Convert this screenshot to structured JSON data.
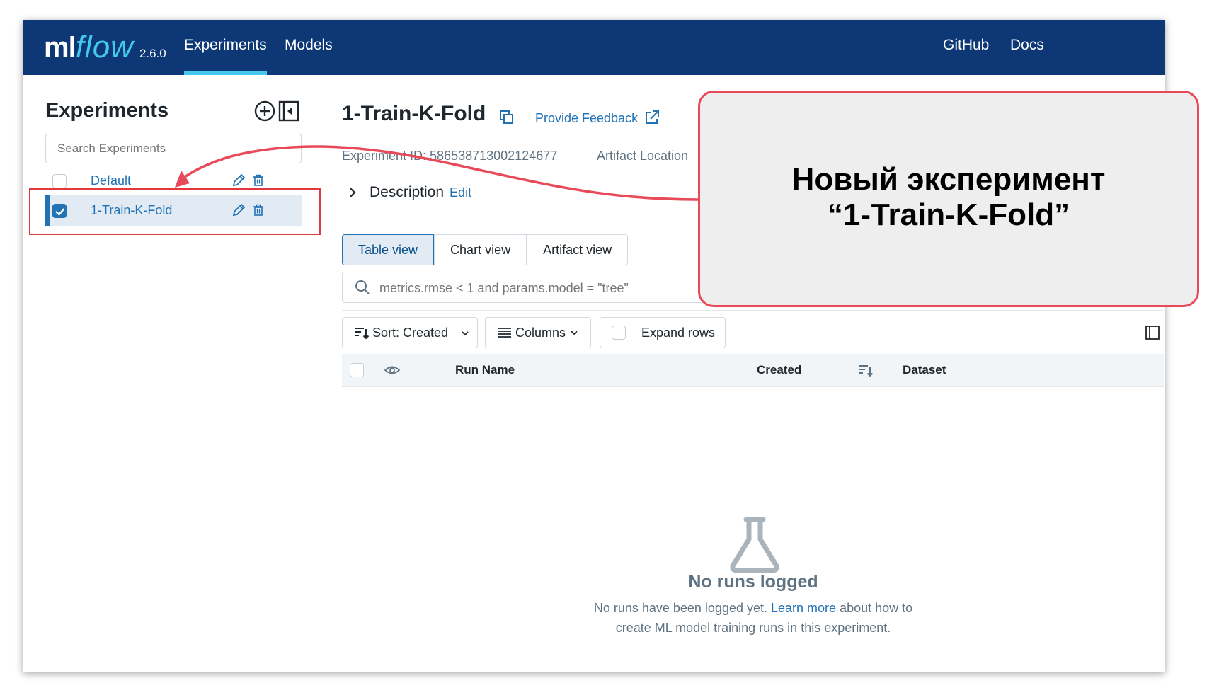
{
  "header": {
    "logo_ml": "ml",
    "logo_flow": "flow",
    "version": "2.6.0",
    "nav": [
      "Experiments",
      "Models"
    ],
    "right_nav": [
      "GitHub",
      "Docs"
    ]
  },
  "sidebar": {
    "title": "Experiments",
    "search_placeholder": "Search Experiments",
    "experiments": [
      {
        "name": "Default",
        "checked": false
      },
      {
        "name": "1-Train-K-Fold",
        "checked": true
      }
    ]
  },
  "main": {
    "title": "1-Train-K-Fold",
    "feedback_link": "Provide Feedback",
    "experiment_id_label": "Experiment ID: 586538713002124677",
    "artifact_label": "Artifact Location",
    "description_label": "Description",
    "description_edit": "Edit",
    "view_tabs": [
      "Table view",
      "Chart view",
      "Artifact view"
    ],
    "filter_placeholder": "metrics.rmse < 1 and params.model = \"tree\"",
    "sort_label": "Sort: Created",
    "columns_label": "Columns",
    "expand_rows_label": "Expand rows",
    "table_columns": [
      "Run Name",
      "Created",
      "Dataset"
    ],
    "empty_title": "No runs logged",
    "empty_text_1": "No runs have been logged yet.",
    "empty_link": "Learn more",
    "empty_text_2": "about how to",
    "empty_text_3": "create ML model training runs in this experiment."
  },
  "annotation": {
    "line1": "Новый эксперимент",
    "line2": "“1-Train-K-Fold”"
  },
  "colors": {
    "header_bg": "#0e3776",
    "accent": "#43c9ed",
    "link": "#2272b4",
    "annotation_border": "#e94a59"
  }
}
